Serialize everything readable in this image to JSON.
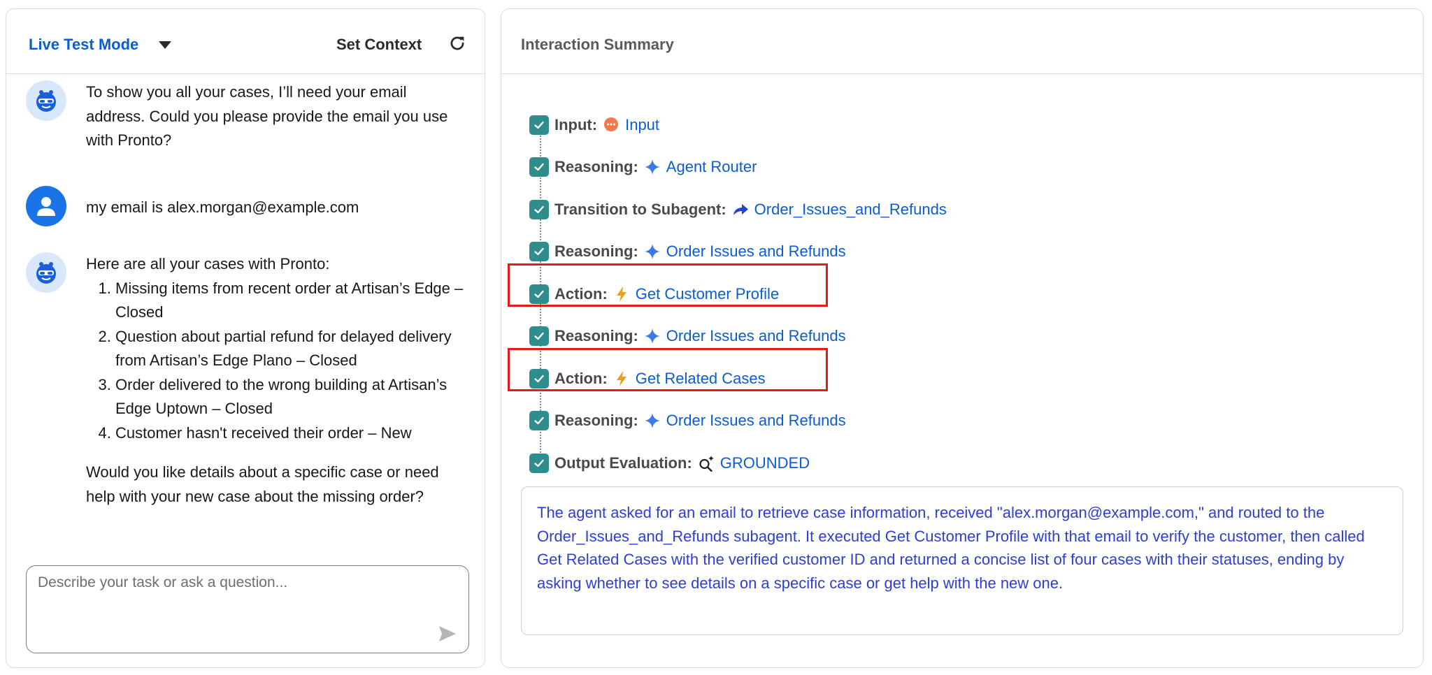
{
  "chat": {
    "mode_label": "Live Test Mode",
    "set_context_label": "Set Context",
    "messages": [
      {
        "role": "agent",
        "text": "To show you all your cases, I’ll need your email address. Could you please provide the email you use with Pronto?"
      },
      {
        "role": "user",
        "text": "my email is alex.morgan@example.com"
      },
      {
        "role": "agent",
        "intro": "Here are all your cases with Pronto:",
        "list": [
          "Missing items from recent order at Artisan’s Edge – Closed",
          "Question about partial refund for delayed delivery from Artisan’s Edge Plano – Closed",
          "Order delivered to the wrong building at Artisan’s Edge Uptown – Closed",
          "Customer hasn't received their order – New"
        ],
        "outro": "Would you like details about a specific case or need help with your new case about the missing order?"
      }
    ],
    "input_placeholder": "Describe your task or ask a question..."
  },
  "summary": {
    "title": "Interaction Summary",
    "steps": [
      {
        "label": "Input:",
        "icon": "chat-bubble-icon",
        "value": "Input"
      },
      {
        "label": "Reasoning:",
        "icon": "sparkle-icon",
        "value": "Agent Router"
      },
      {
        "label": "Transition to Subagent:",
        "icon": "arrow-forward-icon",
        "value": "Order_Issues_and_Refunds"
      },
      {
        "label": "Reasoning:",
        "icon": "sparkle-icon",
        "value": "Order Issues and Refunds"
      },
      {
        "label": "Action:",
        "icon": "lightning-icon",
        "value": "Get Customer Profile"
      },
      {
        "label": "Reasoning:",
        "icon": "sparkle-icon",
        "value": "Order Issues and Refunds"
      },
      {
        "label": "Action:",
        "icon": "lightning-icon",
        "value": "Get Related Cases"
      },
      {
        "label": "Reasoning:",
        "icon": "sparkle-icon",
        "value": "Order Issues and Refunds"
      },
      {
        "label": "Output Evaluation:",
        "icon": "search-sparkle-icon",
        "value": "GROUNDED"
      }
    ],
    "description": "The agent asked for an email to retrieve case information, received \"alex.morgan@example.com,\" and routed to the Order_Issues_and_Refunds subagent. It executed Get Customer Profile with that email to verify the customer, then called Get Related Cases with the verified customer ID and returned a concise list of four cases with their statuses, ending by asking whether to see details on a specific case or get help with the new one."
  },
  "colors": {
    "link_blue": "#0b5cd5",
    "check_teal": "#2f8d8d",
    "highlight_red": "#e21b1b",
    "summary_text_blue": "#2c3ed6"
  }
}
